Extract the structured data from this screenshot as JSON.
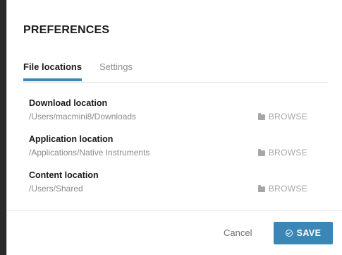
{
  "dialog": {
    "title": "PREFERENCES",
    "tabs": [
      {
        "label": "File locations",
        "active": true
      },
      {
        "label": "Settings",
        "active": false
      }
    ],
    "rows": [
      {
        "label": "Download location",
        "path": "/Users/macmini8/Downloads",
        "browse": "BROWSE"
      },
      {
        "label": "Application location",
        "path": "/Applications/Native Instruments",
        "browse": "BROWSE"
      },
      {
        "label": "Content location",
        "path": "/Users/Shared",
        "browse": "BROWSE"
      }
    ],
    "footer": {
      "cancel_label": "Cancel",
      "save_label": "SAVE"
    }
  },
  "colors": {
    "accent": "#3a87b7",
    "background": "#2b2b2b"
  },
  "icons": {
    "browse": "folder-icon",
    "save": "check-circle-icon"
  }
}
